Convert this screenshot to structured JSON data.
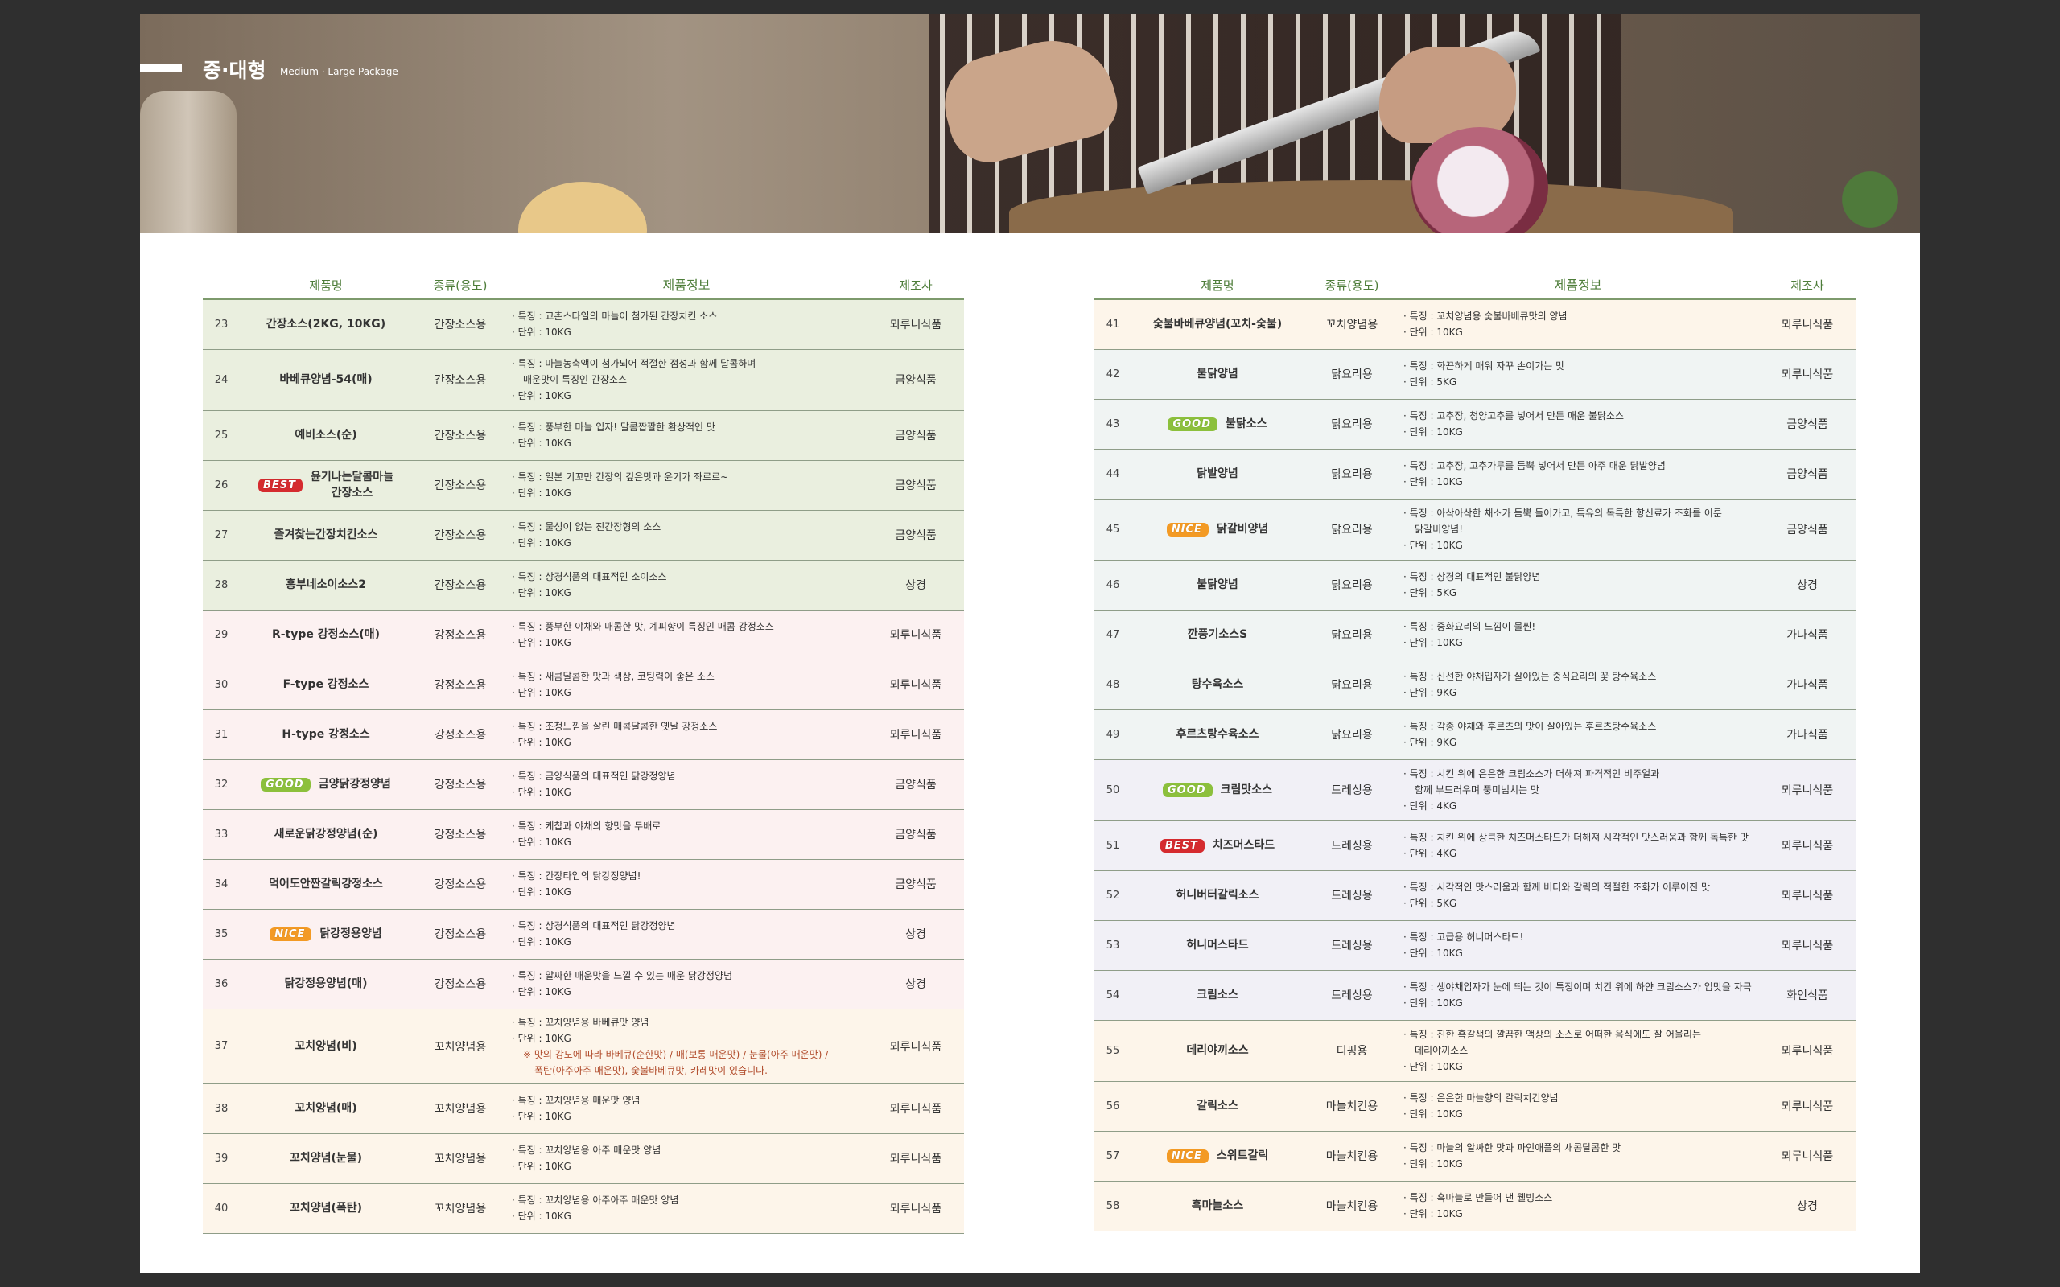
{
  "header": {
    "title": "중·대형",
    "subtitle": "Medium · Large Package"
  },
  "colors": {
    "heading_green": "#4e7d3a",
    "best": "#d52b2f",
    "good": "#8cc03c",
    "nice": "#f39a24"
  },
  "table_headers": {
    "name": "제품명",
    "type": "종류(용도)",
    "info": "제품정보",
    "maker": "제조사"
  },
  "left_rows": [
    {
      "no": "23",
      "name": [
        "간장소스(2KG, 10KG)"
      ],
      "type": "간장소스용",
      "lines": [
        "· 특징 : 교촌스타일의 마늘이 첨가된 간장치킨 소스",
        "· 단위 : 10KG"
      ],
      "maker": "뫼루니식품"
    },
    {
      "no": "24",
      "name": [
        "바베큐양념-54(매)"
      ],
      "type": "간장소스용",
      "lines": [
        "· 특징 : 마늘농축액이 첨가되어 적절한 점성과 함께 달콤하며",
        "매운맛이 특징인 간장소스",
        "· 단위 : 10KG"
      ],
      "maker": "금양식품"
    },
    {
      "no": "25",
      "name": [
        "예비소스(순)"
      ],
      "type": "간장소스용",
      "lines": [
        "· 특징 : 풍부한 마늘 입자! 달콤짭짤한 환상적인 맛",
        "· 단위 : 10KG"
      ],
      "maker": "금양식품"
    },
    {
      "no": "26",
      "badge": "BEST",
      "name": [
        "윤기나는달콤마늘",
        "간장소스"
      ],
      "type": "간장소스용",
      "lines": [
        "· 특징 : 일본 기꼬만 간장의 깊은맛과 윤기가 좌르르~",
        "· 단위 : 10KG"
      ],
      "maker": "금양식품"
    },
    {
      "no": "27",
      "name": [
        "즐겨찾는간장치킨소스"
      ],
      "type": "간장소스용",
      "lines": [
        "· 특징 : 물성이 없는 진간장형의 소스",
        "· 단위 : 10KG"
      ],
      "maker": "금양식품"
    },
    {
      "no": "28",
      "name": [
        "흥부네소이소스2"
      ],
      "type": "간장소스용",
      "lines": [
        "· 특징 : 상경식품의 대표적인 소이소스",
        "· 단위 : 10KG"
      ],
      "maker": "상경"
    },
    {
      "no": "29",
      "name": [
        "R-type 강정소스(매)"
      ],
      "type": "강정소스용",
      "lines": [
        "· 특징 : 풍부한 야채와 매콤한 맛, 계피향이 특징인 매콤 강정소스",
        "· 단위 : 10KG"
      ],
      "maker": "뫼루니식품"
    },
    {
      "no": "30",
      "name": [
        "F-type 강정소스"
      ],
      "type": "강정소스용",
      "lines": [
        "· 특징 : 새콤달콤한 맛과 색상, 코팅력이 좋은 소스",
        "· 단위 : 10KG"
      ],
      "maker": "뫼루니식품"
    },
    {
      "no": "31",
      "name": [
        "H-type 강정소스"
      ],
      "type": "강정소스용",
      "lines": [
        "· 특징 : 조청느낌을 살린 매콤달콤한 옛날 강정소스",
        "· 단위 : 10KG"
      ],
      "maker": "뫼루니식품"
    },
    {
      "no": "32",
      "badge": "GOOD",
      "name": [
        "금양닭강정양념"
      ],
      "type": "강정소스용",
      "lines": [
        "· 특징 : 금양식품의 대표적인 닭강정양념",
        "· 단위 : 10KG"
      ],
      "maker": "금양식품"
    },
    {
      "no": "33",
      "name": [
        "새로운닭강정양념(순)"
      ],
      "type": "강정소스용",
      "lines": [
        "· 특징 : 케찹과 야채의 향맛을 두배로",
        "· 단위 : 10KG"
      ],
      "maker": "금양식품"
    },
    {
      "no": "34",
      "name": [
        "먹어도안짠갈릭강정소스"
      ],
      "type": "강정소스용",
      "lines": [
        "· 특징 : 간장타입의 닭강정양념!",
        "· 단위 : 10KG"
      ],
      "maker": "금양식품"
    },
    {
      "no": "35",
      "badge": "NICE",
      "name": [
        "닭강정용양념"
      ],
      "type": "강정소스용",
      "lines": [
        "· 특징 : 상경식품의 대표적인 닭강정양념",
        "· 단위 : 10KG"
      ],
      "maker": "상경"
    },
    {
      "no": "36",
      "name": [
        "닭강정용양념(매)"
      ],
      "type": "강정소스용",
      "lines": [
        "· 특징 : 알싸한 매운맛을 느낄 수 있는 매운 닭강정양념",
        "· 단위 : 10KG"
      ],
      "maker": "상경"
    },
    {
      "no": "37",
      "name": [
        "꼬치양념(비)"
      ],
      "type": "꼬치양념용",
      "lines": [
        "· 특징 : 꼬치양념용 바베큐맛 양념",
        "· 단위 : 10KG"
      ],
      "note": [
        "※ 맛의 강도에 따라 바베큐(순한맛) / 매(보통 매운맛) / 눈물(아주 매운맛) /",
        "폭탄(아주아주 매운맛), 숯불바베큐맛, 카레맛이 있습니다."
      ],
      "maker": "뫼루니식품"
    },
    {
      "no": "38",
      "name": [
        "꼬치양념(매)"
      ],
      "type": "꼬치양념용",
      "lines": [
        "· 특징 : 꼬치양념용 매운맛 양념",
        "· 단위 : 10KG"
      ],
      "maker": "뫼루니식품"
    },
    {
      "no": "39",
      "name": [
        "꼬치양념(눈물)"
      ],
      "type": "꼬치양념용",
      "lines": [
        "· 특징 : 꼬치양념용 아주 매운맛 양념",
        "· 단위 : 10KG"
      ],
      "maker": "뫼루니식품"
    },
    {
      "no": "40",
      "name": [
        "꼬치양념(폭탄)"
      ],
      "type": "꼬치양념용",
      "lines": [
        "· 특징 : 꼬치양념용 아주아주 매운맛 양념",
        "· 단위 : 10KG"
      ],
      "maker": "뫼루니식품"
    }
  ],
  "right_rows": [
    {
      "no": "41",
      "name": [
        "숯불바베큐양념(꼬치-숯불)"
      ],
      "type": "꼬치양념용",
      "lines": [
        "· 특징 : 꼬치양념용 숯불바베큐맛의 양념",
        "· 단위 : 10KG"
      ],
      "maker": "뫼루니식품"
    },
    {
      "no": "42",
      "name": [
        "불닭양념"
      ],
      "type": "닭요리용",
      "lines": [
        "· 특징 : 화끈하게 매워 자꾸 손이가는 맛",
        "· 단위 : 5KG"
      ],
      "maker": "뫼루니식품"
    },
    {
      "no": "43",
      "badge": "GOOD",
      "name": [
        "불닭소스"
      ],
      "type": "닭요리용",
      "lines": [
        "· 특징 : 고추장, 청양고추를 넣어서 만든 매운 불닭소스",
        "· 단위 : 10KG"
      ],
      "maker": "금양식품"
    },
    {
      "no": "44",
      "name": [
        "닭발양념"
      ],
      "type": "닭요리용",
      "lines": [
        "· 특징 : 고추장, 고추가루를 듬뿍 넣어서 만든 아주 매운 닭발양념",
        "· 단위 : 10KG"
      ],
      "maker": "금양식품"
    },
    {
      "no": "45",
      "badge": "NICE",
      "name": [
        "닭갈비양념"
      ],
      "type": "닭요리용",
      "lines": [
        "· 특징 : 아삭아삭한 채소가 듬뿍 들어가고, 특유의 독특한 향신료가 조화를 이룬",
        "닭갈비양념!",
        "· 단위 : 10KG"
      ],
      "maker": "금양식품"
    },
    {
      "no": "46",
      "name": [
        "불닭양념"
      ],
      "type": "닭요리용",
      "lines": [
        "· 특징 : 상경의 대표적인 불닭양념",
        "· 단위 : 5KG"
      ],
      "maker": "상경"
    },
    {
      "no": "47",
      "name": [
        "깐풍기소스S"
      ],
      "type": "닭요리용",
      "lines": [
        "· 특징 : 중화요리의 느낌이 물씬!",
        "· 단위 : 10KG"
      ],
      "maker": "가나식품"
    },
    {
      "no": "48",
      "name": [
        "탕수육소스"
      ],
      "type": "닭요리용",
      "lines": [
        "· 특징 : 신선한 야채입자가 살아있는 중식요리의 꽃 탕수육소스",
        "· 단위 : 9KG"
      ],
      "maker": "가나식품"
    },
    {
      "no": "49",
      "name": [
        "후르츠탕수육소스"
      ],
      "type": "닭요리용",
      "lines": [
        "· 특징 : 각종 야채와 후르츠의 맛이 살아있는 후르츠탕수육소스",
        "· 단위 : 9KG"
      ],
      "maker": "가나식품"
    },
    {
      "no": "50",
      "badge": "GOOD",
      "name": [
        "크림맛소스"
      ],
      "type": "드레싱용",
      "lines": [
        "· 특징 : 치킨 위에 은은한 크림소스가 더해져 파격적인 비주얼과",
        "함께 부드러우며 풍미넘치는 맛",
        "· 단위 : 4KG"
      ],
      "maker": "뫼루니식품"
    },
    {
      "no": "51",
      "badge": "BEST",
      "name": [
        "치즈머스타드"
      ],
      "type": "드레싱용",
      "lines": [
        "· 특징 : 치킨 위에 상큼한 치즈머스타드가 더해져 시각적인 맛스러움과 함께 독특한 맛",
        "· 단위 : 4KG"
      ],
      "maker": "뫼루니식품"
    },
    {
      "no": "52",
      "name": [
        "허니버터갈릭소스"
      ],
      "type": "드레싱용",
      "lines": [
        "· 특징 : 시각적인 맛스러움과 함께 버터와 갈릭의 적절한 조화가 이루어진 맛",
        "· 단위 : 5KG"
      ],
      "maker": "뫼루니식품"
    },
    {
      "no": "53",
      "name": [
        "허니머스타드"
      ],
      "type": "드레싱용",
      "lines": [
        "· 특징 : 고급용 허니머스타드!",
        "· 단위 : 10KG"
      ],
      "maker": "뫼루니식품"
    },
    {
      "no": "54",
      "name": [
        "크림소스"
      ],
      "type": "드레싱용",
      "lines": [
        "· 특징 : 생야채입자가 눈에 띄는 것이 특징이며 치킨 위에 하얀 크림소스가 입맛을 자극",
        "· 단위 : 10KG"
      ],
      "maker": "화인식품"
    },
    {
      "no": "55",
      "name": [
        "데리야끼소스"
      ],
      "type": "디핑용",
      "lines": [
        "· 특징 : 진한 흑갈색의 깔끔한 액상의 소스로 어떠한 음식에도 잘 어울리는",
        "데리야끼소스",
        "· 단위 : 10KG"
      ],
      "maker": "뫼루니식품"
    },
    {
      "no": "56",
      "name": [
        "갈릭소스"
      ],
      "type": "마늘치킨용",
      "lines": [
        "· 특징 : 은은한 마늘향의 갈릭치킨양념",
        "· 단위 : 10KG"
      ],
      "maker": "뫼루니식품"
    },
    {
      "no": "57",
      "badge": "NICE",
      "name": [
        "스위트갈릭"
      ],
      "type": "마늘치킨용",
      "lines": [
        "· 특징 : 마늘의 알싸한 맛과 파인애플의 새콤달콤한 맛",
        "· 단위 : 10KG"
      ],
      "maker": "뫼루니식품"
    },
    {
      "no": "58",
      "name": [
        "흑마늘소스"
      ],
      "type": "마늘치킨용",
      "lines": [
        "· 특징 : 흑마늘로 만들어 낸 웰빙소스",
        "· 단위 : 10KG"
      ],
      "maker": "상경"
    }
  ]
}
